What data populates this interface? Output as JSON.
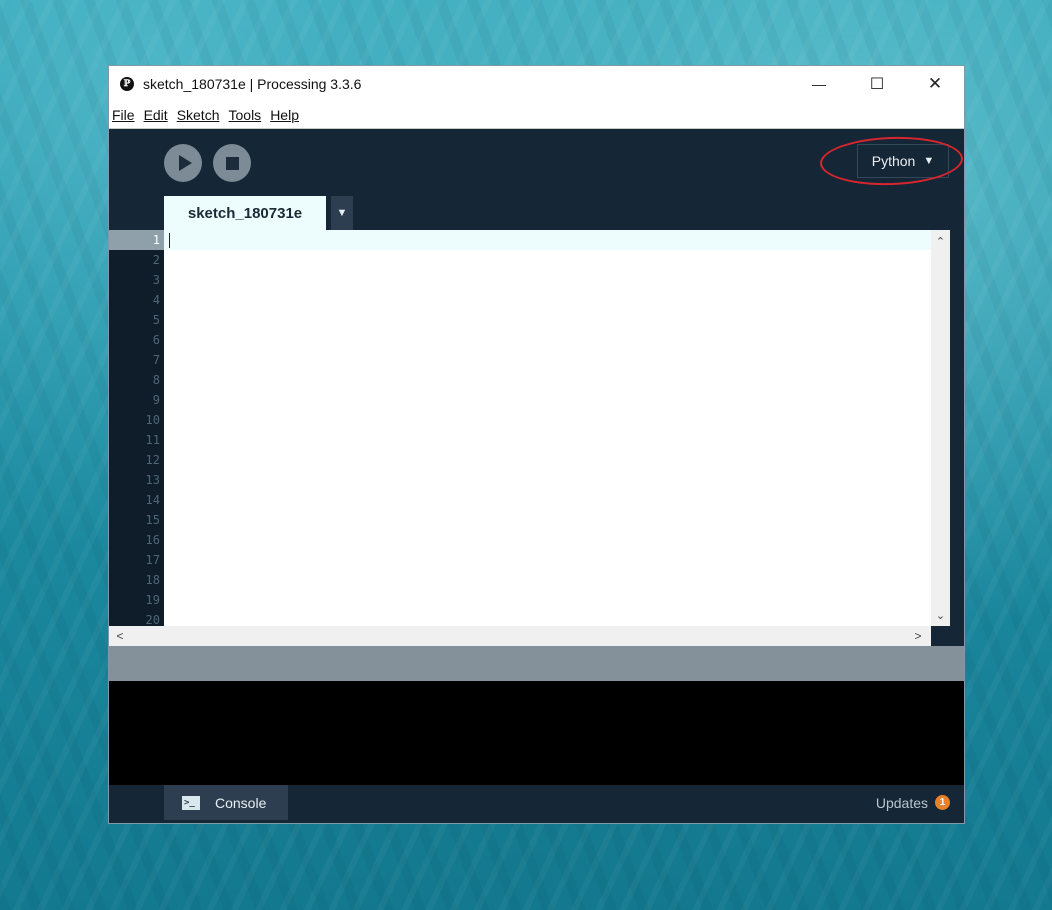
{
  "window": {
    "title": "sketch_180731e | Processing 3.3.6",
    "app_icon_glyph": "ℙ",
    "minimize_glyph": "—",
    "maximize_glyph": "☐",
    "close_glyph": "✕"
  },
  "menu": {
    "items": [
      "File",
      "Edit",
      "Sketch",
      "Tools",
      "Help"
    ]
  },
  "toolbar": {
    "mode_label": "Python",
    "mode_arrow": "▼"
  },
  "tabs": {
    "active_tab": "sketch_180731e",
    "menu_arrow": "▼"
  },
  "editor": {
    "line_numbers": [
      "1",
      "2",
      "3",
      "4",
      "5",
      "6",
      "7",
      "8",
      "9",
      "10",
      "11",
      "12",
      "13",
      "14",
      "15",
      "16",
      "17",
      "18",
      "19",
      "20"
    ],
    "current_line": 1,
    "code": ""
  },
  "scroll": {
    "up": "⌃",
    "down": "⌄",
    "left": "<",
    "right": ">"
  },
  "footer": {
    "console_label": "Console",
    "console_icon_glyph": ">_",
    "updates_label": "Updates",
    "updates_count": "1"
  },
  "colors": {
    "accent_mode_highlight": "#d7262e",
    "updates_badge": "#e7812a",
    "editor_bg": "#152636"
  },
  "icons": {
    "run": "play-icon",
    "stop": "stop-icon",
    "console": "terminal-icon"
  }
}
